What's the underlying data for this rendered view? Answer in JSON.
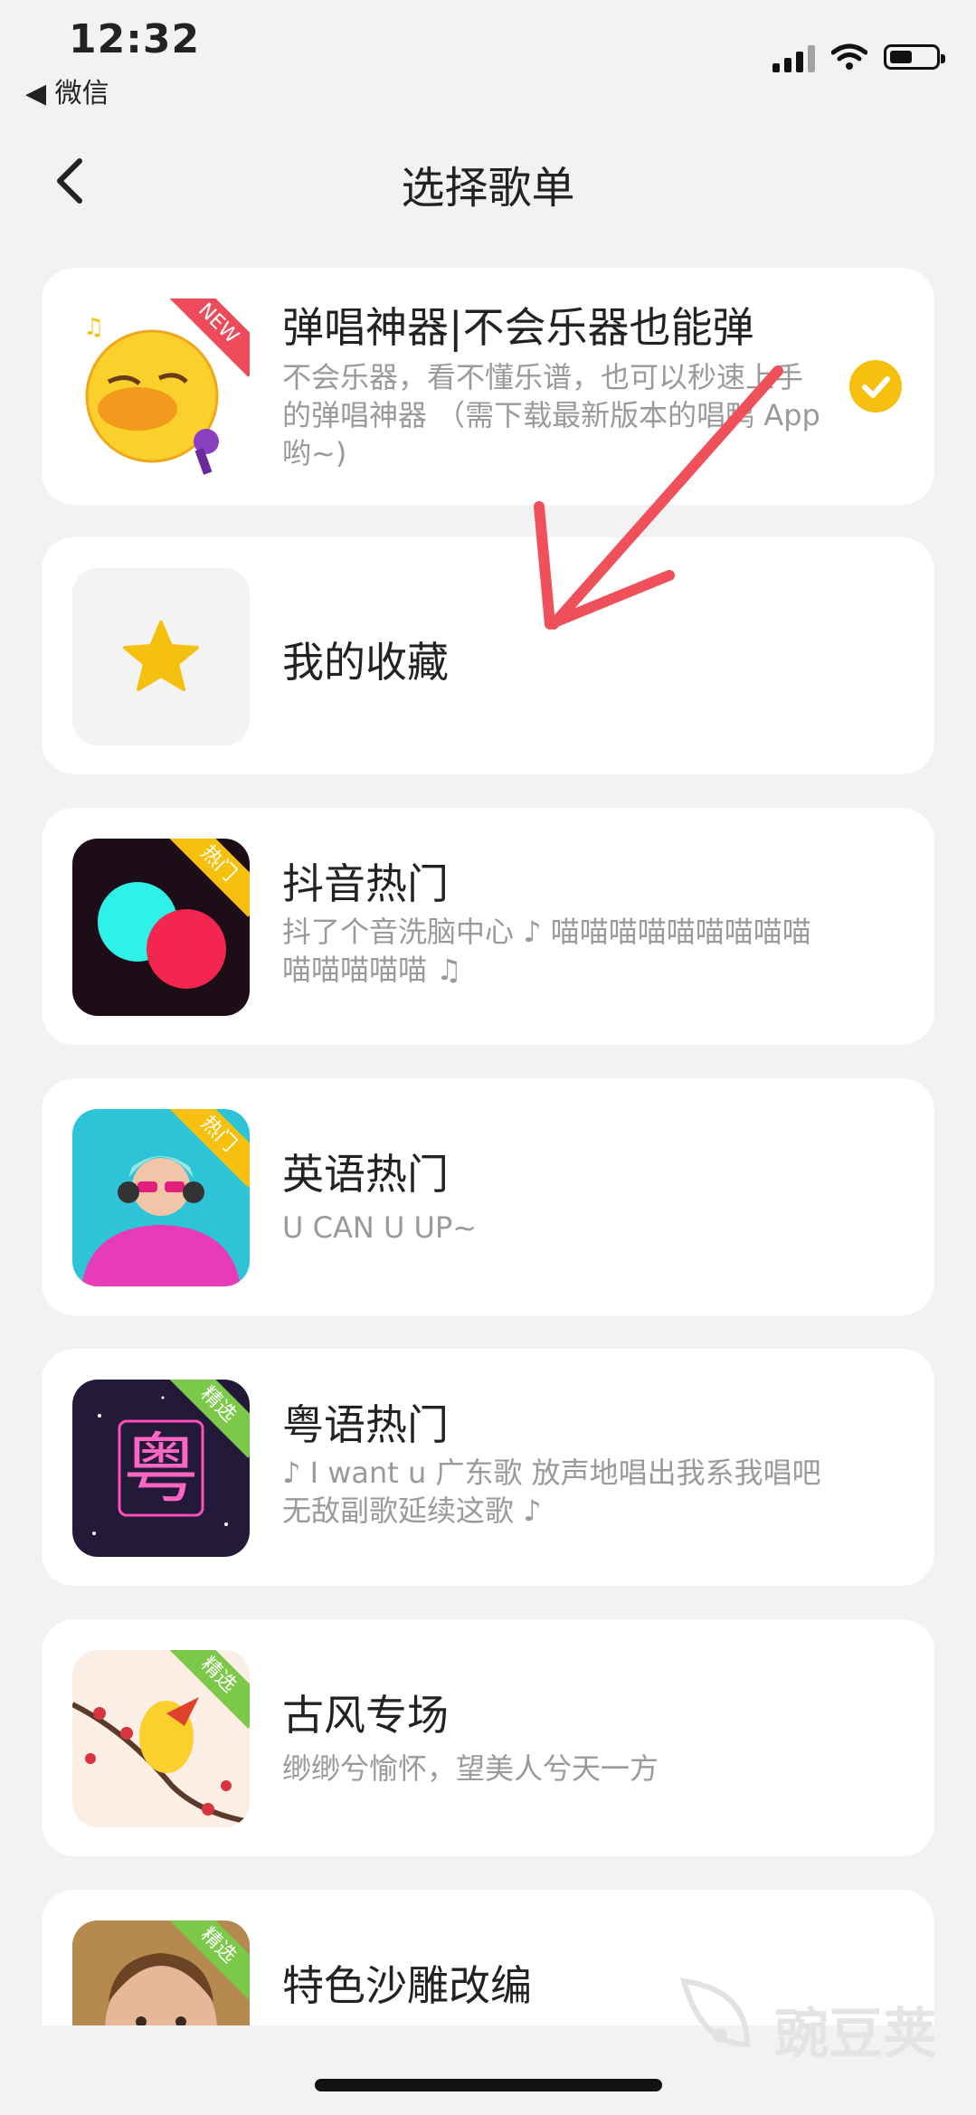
{
  "status_bar": {
    "time": "12:32",
    "back_app": "◀ 微信"
  },
  "header": {
    "title": "选择歌单"
  },
  "playlists": [
    {
      "title": "弹唱神器|不会乐器也能弹",
      "desc": "不会乐器，看不懂乐谱，也可以秒速上手的弹唱神器 （需下载最新版本的唱鸭 App 哟~)",
      "badge": "NEW",
      "selected": true
    },
    {
      "title": "我的收藏",
      "desc": "",
      "badge": ""
    },
    {
      "title": "抖音热门",
      "desc": "抖了个音洗脑中心 ♪ 喵喵喵喵喵喵喵喵喵喵喵喵喵喵 ♫",
      "badge": "热门"
    },
    {
      "title": "英语热门",
      "desc": "U CAN U UP~",
      "badge": "热门"
    },
    {
      "title": "粤语热门",
      "desc": "♪ I want u 广东歌 放声地唱出我系我唱吧无敌副歌延续这歌 ♪",
      "badge": "精选",
      "thumb_text": "粤"
    },
    {
      "title": "古风专场",
      "desc": "缈缈兮愉怀，望美人兮天一方",
      "badge": "精选"
    },
    {
      "title": "特色沙雕改编",
      "desc": "",
      "badge": "精选"
    }
  ],
  "watermark": "豌豆荚",
  "colors": {
    "accent": "#f5c10e",
    "hot_badge": "#f5c10e",
    "pick_badge": "#7cc94a",
    "new_badge": "#ee4b5a",
    "arrow": "#f0505a"
  }
}
